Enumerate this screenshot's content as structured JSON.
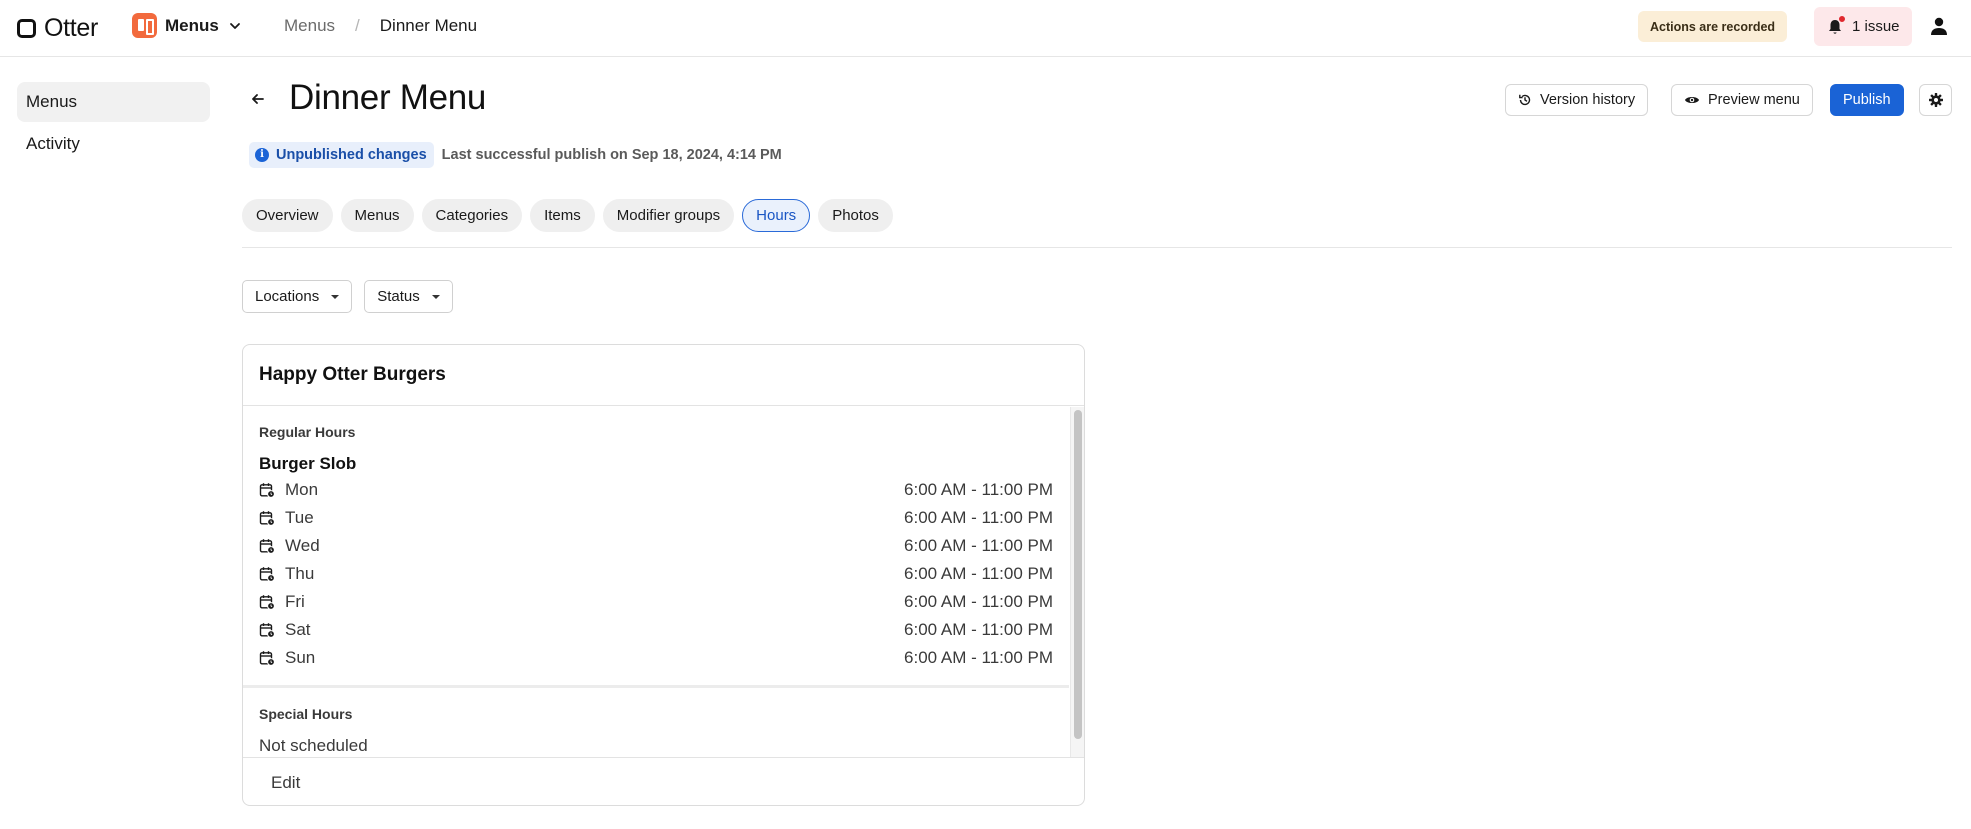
{
  "brand": {
    "name": "Otter"
  },
  "app_switcher": {
    "label": "Menus",
    "icon": "menus-app-icon"
  },
  "breadcrumb": {
    "parent": "Menus",
    "current": "Dinner Menu"
  },
  "top_right": {
    "recorded_badge": "Actions are recorded",
    "issues_label": "1 issue",
    "colors": {
      "recorded_bg": "#fbeed7",
      "issues_bg": "#fde8ea",
      "alert_dot": "#e0282e"
    }
  },
  "sidebar": {
    "items": [
      {
        "label": "Menus",
        "active": true
      },
      {
        "label": "Activity",
        "active": false
      }
    ]
  },
  "header": {
    "title": "Dinner Menu",
    "version_history_label": "Version history",
    "preview_label": "Preview menu",
    "publish_label": "Publish",
    "accent": "#1a63d6"
  },
  "status": {
    "unpublished_label": "Unpublished changes",
    "last_publish": "Last successful publish on Sep 18, 2024, 4:14 PM"
  },
  "tabs": [
    {
      "label": "Overview",
      "active": false
    },
    {
      "label": "Menus",
      "active": false
    },
    {
      "label": "Categories",
      "active": false
    },
    {
      "label": "Items",
      "active": false
    },
    {
      "label": "Modifier groups",
      "active": false
    },
    {
      "label": "Hours",
      "active": true
    },
    {
      "label": "Photos",
      "active": false
    }
  ],
  "filters": {
    "locations_label": "Locations",
    "status_label": "Status"
  },
  "card": {
    "store_name": "Happy Otter Burgers",
    "regular_hours_label": "Regular Hours",
    "location_name": "Burger Slob",
    "days": [
      {
        "day": "Mon",
        "hours": "6:00 AM - 11:00 PM"
      },
      {
        "day": "Tue",
        "hours": "6:00 AM - 11:00 PM"
      },
      {
        "day": "Wed",
        "hours": "6:00 AM - 11:00 PM"
      },
      {
        "day": "Thu",
        "hours": "6:00 AM - 11:00 PM"
      },
      {
        "day": "Fri",
        "hours": "6:00 AM - 11:00 PM"
      },
      {
        "day": "Sat",
        "hours": "6:00 AM - 11:00 PM"
      },
      {
        "day": "Sun",
        "hours": "6:00 AM - 11:00 PM"
      }
    ],
    "special_hours_label": "Special Hours",
    "special_hours_value": "Not scheduled",
    "edit_label": "Edit"
  }
}
